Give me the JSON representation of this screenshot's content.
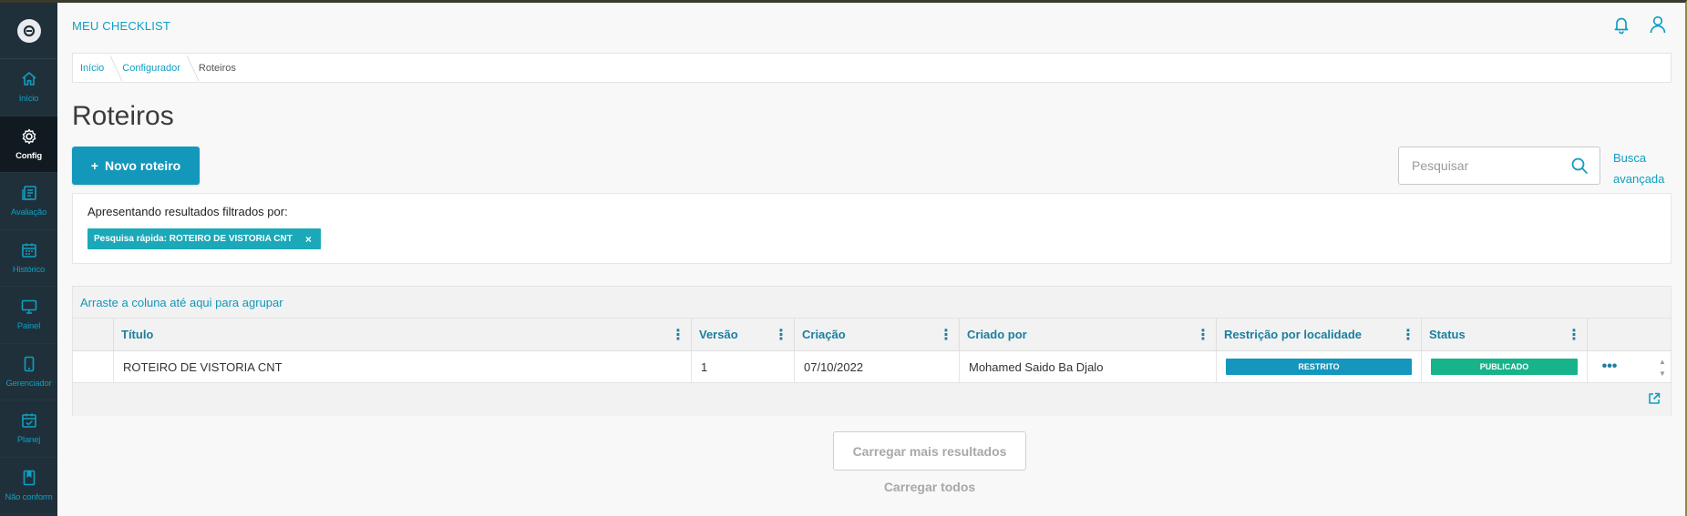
{
  "sidebar": {
    "items": [
      {
        "label": "Início",
        "icon": "home-icon"
      },
      {
        "label": "Config",
        "icon": "gear-icon",
        "active": true
      },
      {
        "label": "Avaliação",
        "icon": "evaluation-icon"
      },
      {
        "label": "Histórico",
        "icon": "calendar-icon"
      },
      {
        "label": "Painel",
        "icon": "monitor-icon"
      },
      {
        "label": "Gerenciador",
        "icon": "mobile-icon"
      },
      {
        "label": "Planej",
        "icon": "calendar-check-icon"
      },
      {
        "label": "Não conform",
        "icon": "bookmark-icon"
      }
    ]
  },
  "header": {
    "app_title": "MEU CHECKLIST",
    "icons": [
      "bell-icon",
      "user-icon"
    ]
  },
  "breadcrumb": [
    "Início",
    "Configurador",
    "Roteiros"
  ],
  "page": {
    "title": "Roteiros",
    "new_button": "Novo roteiro",
    "new_button_icon": "+",
    "search_placeholder": "Pesquisar",
    "advanced_search_line1": "Busca",
    "advanced_search_line2": "avançada"
  },
  "filters": {
    "title": "Apresentando resultados filtrados por:",
    "chip": "Pesquisa rápida: ROTEIRO DE VISTORIA CNT",
    "chip_close": "×"
  },
  "grid": {
    "group_hint": "Arraste a coluna até aqui para agrupar",
    "columns": [
      "Título",
      "Versão",
      "Criação",
      "Criado por",
      "Restrição por localidade",
      "Status"
    ],
    "rows": [
      {
        "titulo": "ROTEIRO DE VISTORIA CNT",
        "versao": "1",
        "criacao": "07/10/2022",
        "criado_por": "Mohamed Saido Ba Djalo",
        "restricao": "RESTRITO",
        "status": "PUBLICADO",
        "menu": "•••"
      }
    ]
  },
  "actions": {
    "load_more": "Carregar mais resultados",
    "load_all": "Carregar todos"
  },
  "colors": {
    "accent": "#0f9fc2",
    "sidebar_bg": "#20303a",
    "restricted": "#1496bd",
    "published": "#17b38a"
  }
}
